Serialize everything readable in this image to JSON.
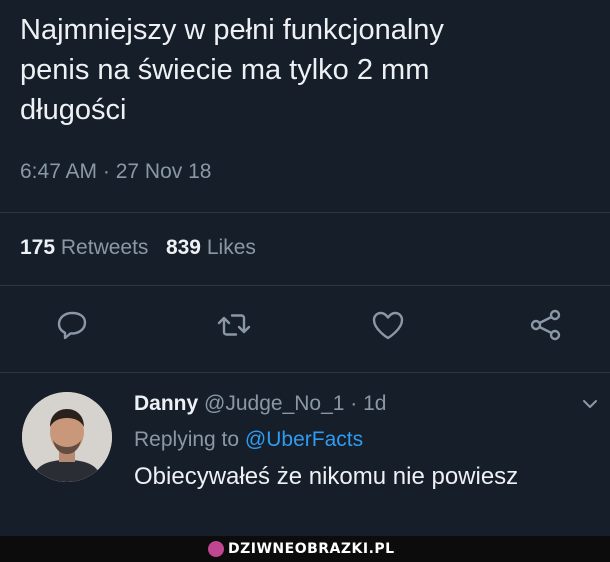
{
  "tweet": {
    "text_lines": [
      "Najmniejszy w pełni funkcjonalny",
      "penis na świecie ma tylko 2 mm",
      "długości"
    ],
    "timestamp": "6:47 AM · 27 Nov 18",
    "retweets_count": "175",
    "retweets_label": "Retweets",
    "likes_count": "839",
    "likes_label": "Likes"
  },
  "actions": {
    "icons": [
      "reply-icon",
      "retweet-icon",
      "like-icon",
      "share-icon"
    ],
    "color": "#8a98a6"
  },
  "reply": {
    "name": "Danny",
    "handle_time": "@Judge_No_1 · 1d",
    "replying_prefix": "Replying to ",
    "replying_to": "@UberFacts",
    "text": "Obiecywałeś że nikomu nie powiesz"
  },
  "watermark": {
    "text": "DZIWNEOBRAZKI.PL"
  },
  "colors": {
    "background": "#161e29",
    "accent": "#2f9bf0",
    "muted": "#8a98a6"
  }
}
